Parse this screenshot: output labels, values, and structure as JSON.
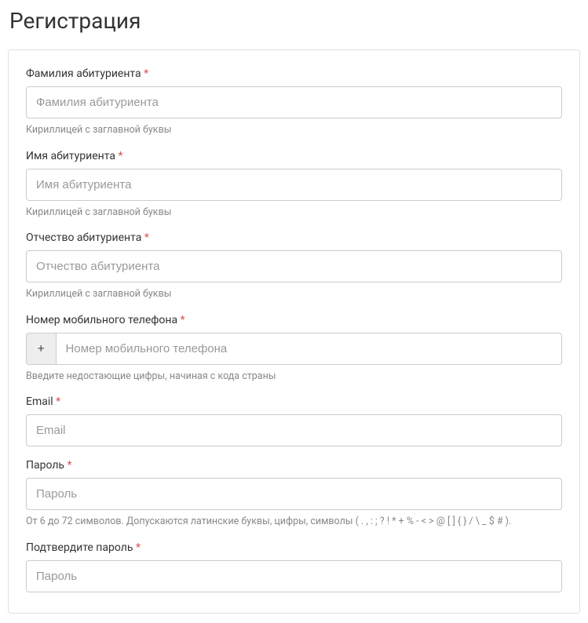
{
  "title": "Регистрация",
  "required_mark": "*",
  "fields": {
    "lastname": {
      "label": "Фамилия абитуриента",
      "placeholder": "Фамилия абитуриента",
      "help": "Кириллицей с заглавной буквы"
    },
    "firstname": {
      "label": "Имя абитуриента",
      "placeholder": "Имя абитуриента",
      "help": "Кириллицей с заглавной буквы"
    },
    "patronymic": {
      "label": "Отчество абитуриента",
      "placeholder": "Отчество абитуриента",
      "help": "Кириллицей с заглавной буквы"
    },
    "phone": {
      "label": "Номер мобильного телефона",
      "prefix": "+",
      "placeholder": "Номер мобильного телефона",
      "help": "Введите недостающие цифры, начиная с кода страны"
    },
    "email": {
      "label": "Email",
      "placeholder": "Email"
    },
    "password": {
      "label": "Пароль",
      "placeholder": "Пароль",
      "help": "От 6 до 72 символов. Допускаются латинские буквы, цифры, символы ( . , : ; ? ! * + % - < > @ [ ] { } / \\ _ $ # )."
    },
    "password_confirm": {
      "label": "Подтвердите пароль",
      "placeholder": "Пароль"
    }
  }
}
